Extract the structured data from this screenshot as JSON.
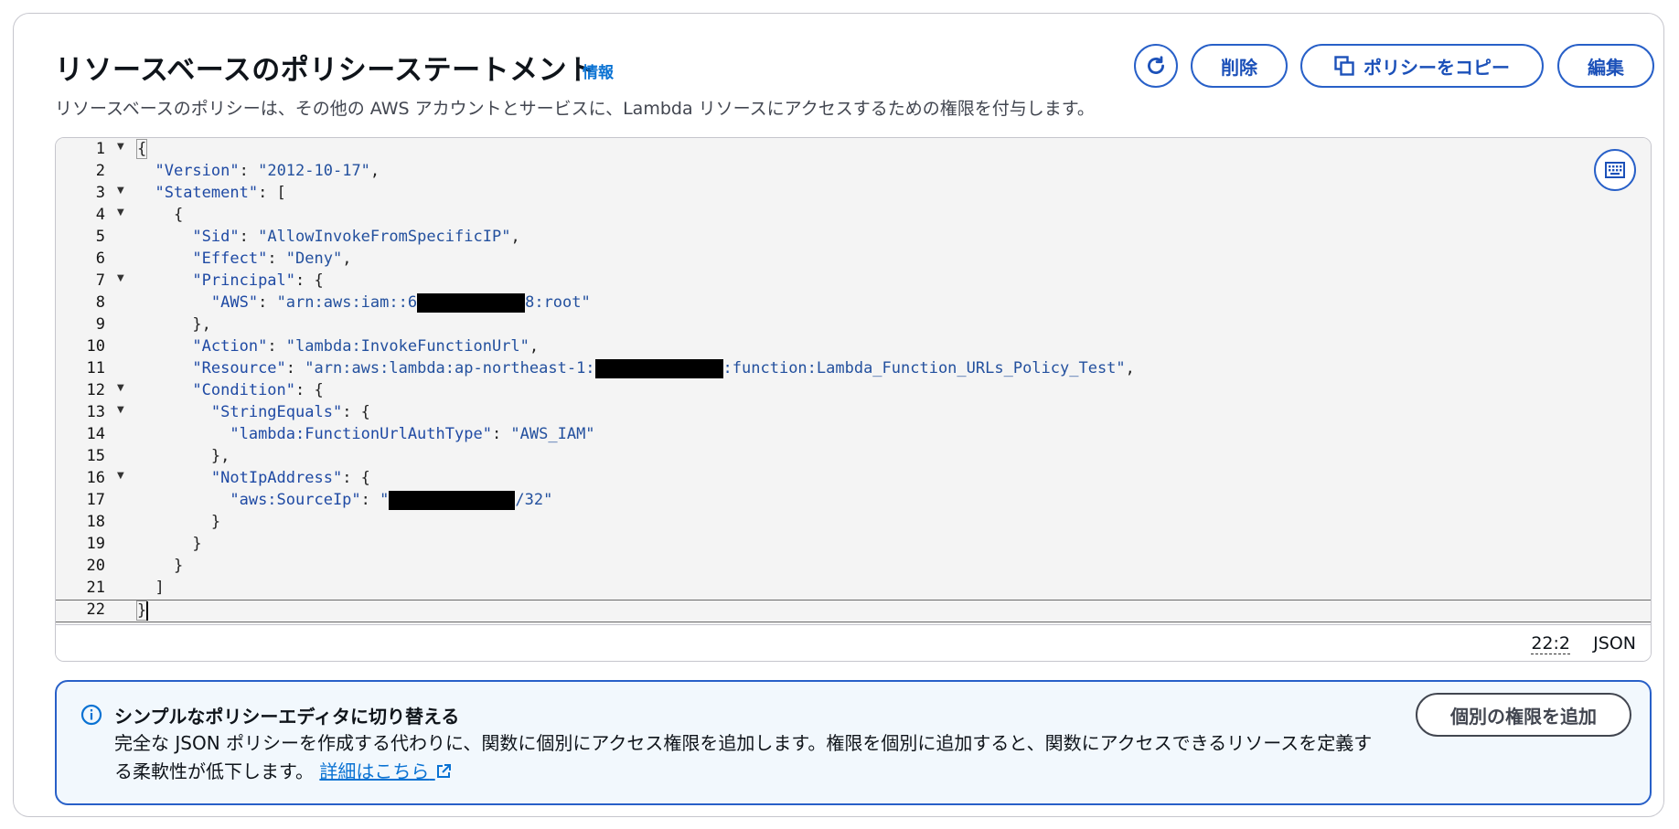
{
  "header": {
    "title": "リソースベースのポリシーステートメント",
    "info_link": "情報",
    "description": "リソースベースのポリシーは、その他の AWS アカウントとサービスに、Lambda リソースにアクセスするための権限を付与します。"
  },
  "toolbar": {
    "refresh_icon": "refresh-icon",
    "delete_label": "削除",
    "copy_label": "ポリシーをコピー",
    "edit_label": "編集"
  },
  "editor": {
    "line_numbers": [
      "1",
      "2",
      "3",
      "4",
      "5",
      "6",
      "7",
      "8",
      "9",
      "10",
      "11",
      "12",
      "13",
      "14",
      "15",
      "16",
      "17",
      "18",
      "19",
      "20",
      "21",
      "22"
    ],
    "tokens": {
      "open_brace": "{",
      "version_key": "\"Version\"",
      "version_val": "\"2012-10-17\"",
      "statement_key": "\"Statement\"",
      "sid_key": "\"Sid\"",
      "sid_val": "\"AllowInvokeFromSpecificIP\"",
      "effect_key": "\"Effect\"",
      "effect_val": "\"Deny\"",
      "principal_key": "\"Principal\"",
      "aws_key": "\"AWS\"",
      "aws_val_prefix": "\"arn:aws:iam::6",
      "aws_val_suffix": "8:root\"",
      "action_key": "\"Action\"",
      "action_val": "\"lambda:InvokeFunctionUrl\"",
      "resource_key": "\"Resource\"",
      "resource_val_prefix": "\"arn:aws:lambda:ap-northeast-1:",
      "resource_val_suffix": ":function:Lambda_Function_URLs_Policy_Test\"",
      "condition_key": "\"Condition\"",
      "stringequals_key": "\"StringEquals\"",
      "authtype_key": "\"lambda:FunctionUrlAuthType\"",
      "authtype_val": "\"AWS_IAM\"",
      "notip_key": "\"NotIpAddress\"",
      "sourceip_key": "\"aws:SourceIp\"",
      "sourceip_val_prefix": "\"",
      "sourceip_val_suffix": "/32\"",
      "close_brace": "}"
    },
    "cursor_position": "22:2",
    "language": "JSON",
    "keyboard_icon": "keyboard-icon"
  },
  "alert": {
    "title": "シンプルなポリシーエディタに切り替える",
    "body": "完全な JSON ポリシーを作成する代わりに、関数に個別にアクセス権限を追加します。権限を個別に追加すると、関数にアクセスできるリソースを定義する柔軟性が低下します。",
    "link_label": "詳細はこちら",
    "add_button_label": "個別の権限を追加"
  },
  "colors": {
    "accent": "#2860c8",
    "link": "#0972d3",
    "alert_bg": "#f2f8fd"
  }
}
